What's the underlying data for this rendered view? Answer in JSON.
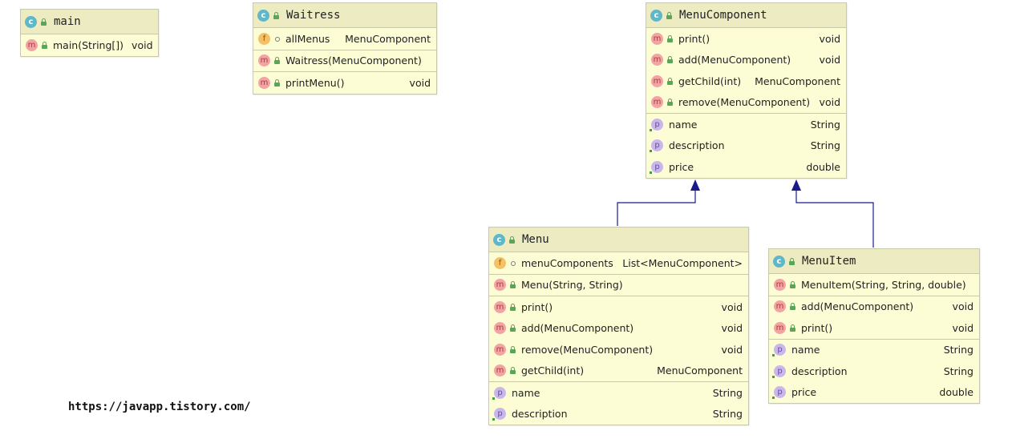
{
  "classes": {
    "main": {
      "name": "main",
      "sections": [
        [
          {
            "kind": "m",
            "name": "main(String[])",
            "type": "void"
          }
        ]
      ]
    },
    "waitress": {
      "name": "Waitress",
      "sections": [
        [
          {
            "kind": "f",
            "name": "allMenus",
            "type": "MenuComponent"
          }
        ],
        [
          {
            "kind": "m",
            "name": "Waitress(MenuComponent)",
            "type": ""
          }
        ],
        [
          {
            "kind": "m",
            "name": "printMenu()",
            "type": "void"
          }
        ]
      ]
    },
    "menu_component": {
      "name": "MenuComponent",
      "sections": [
        [
          {
            "kind": "m",
            "name": "print()",
            "type": "void"
          },
          {
            "kind": "m",
            "name": "add(MenuComponent)",
            "type": "void"
          },
          {
            "kind": "m",
            "name": "getChild(int)",
            "type": "MenuComponent"
          },
          {
            "kind": "m",
            "name": "remove(MenuComponent)",
            "type": "void"
          }
        ],
        [
          {
            "kind": "p",
            "name": "name",
            "type": "String"
          },
          {
            "kind": "p",
            "name": "description",
            "type": "String"
          },
          {
            "kind": "p",
            "name": "price",
            "type": "double"
          }
        ]
      ]
    },
    "menu": {
      "name": "Menu",
      "sections": [
        [
          {
            "kind": "f",
            "name": "menuComponents",
            "type": "List<MenuComponent>"
          }
        ],
        [
          {
            "kind": "m",
            "name": "Menu(String, String)",
            "type": ""
          }
        ],
        [
          {
            "kind": "m",
            "name": "print()",
            "type": "void"
          },
          {
            "kind": "m",
            "name": "add(MenuComponent)",
            "type": "void"
          },
          {
            "kind": "m",
            "name": "remove(MenuComponent)",
            "type": "void"
          },
          {
            "kind": "m",
            "name": "getChild(int)",
            "type": "MenuComponent"
          }
        ],
        [
          {
            "kind": "p",
            "name": "name",
            "type": "String"
          },
          {
            "kind": "p",
            "name": "description",
            "type": "String"
          }
        ]
      ]
    },
    "menu_item": {
      "name": "MenuItem",
      "sections": [
        [
          {
            "kind": "m",
            "name": "MenuItem(String, String, double)",
            "type": ""
          }
        ],
        [
          {
            "kind": "m",
            "name": "add(MenuComponent)",
            "type": "void"
          },
          {
            "kind": "m",
            "name": "print()",
            "type": "void"
          }
        ],
        [
          {
            "kind": "p",
            "name": "name",
            "type": "String"
          },
          {
            "kind": "p",
            "name": "description",
            "type": "String"
          },
          {
            "kind": "p",
            "name": "price",
            "type": "double"
          }
        ]
      ]
    }
  },
  "icons": {
    "class": "c",
    "method": "m",
    "field": "f",
    "property": "p"
  },
  "colors": {
    "box_fill": "#fcfcd5",
    "header_fill": "#ecebc2",
    "edge": "#1a1a8c"
  },
  "watermark": "https://javapp.tistory.com/"
}
